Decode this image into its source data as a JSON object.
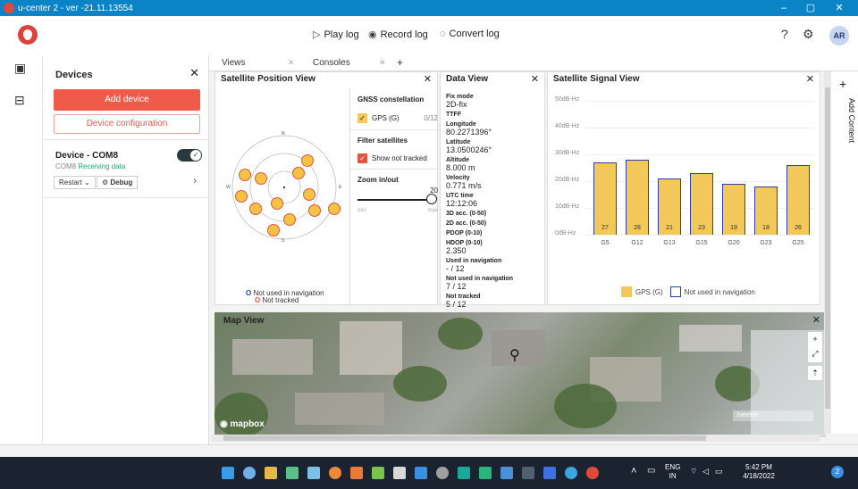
{
  "window": {
    "title": "u-center 2 - ver -21.11.13554",
    "min_label": "–",
    "max_label": "▢",
    "close_label": "✕"
  },
  "toolbar": {
    "play_label": "Play log",
    "record_label": "Record log",
    "convert_label": "Convert log",
    "avatar": "AR"
  },
  "devices": {
    "title": "Devices",
    "add_label": "Add device",
    "config_label": "Device configuration",
    "device": {
      "name": "Device - COM8",
      "port": "COM8",
      "status": "Receiving data",
      "connected": true,
      "restart_label": "Restart",
      "debug_label": "Debug"
    }
  },
  "tabs": [
    {
      "label": "Views"
    },
    {
      "label": "Consoles"
    }
  ],
  "satellite_position": {
    "title": "Satellite Position View",
    "constellation_heading": "GNSS constellation",
    "constellation": {
      "label": "GPS (G)",
      "count": "0/12",
      "checked": true
    },
    "filter_heading": "Filter satellites",
    "filter": {
      "label": "Show not tracked",
      "checked": true
    },
    "zoom_heading": "Zoom in/out",
    "zoom_value": "20",
    "zoom_min": "min",
    "zoom_max": "max",
    "compass": {
      "n": "N",
      "s": "S",
      "e": "E",
      "w": "W"
    },
    "legend_not_used": "Not used in navigation",
    "legend_not_tracked": "Not tracked"
  },
  "data_view": {
    "title": "Data View",
    "fields": [
      {
        "label": "Fix mode",
        "value": "2D-fix"
      },
      {
        "label": "TTFF",
        "value": ""
      },
      {
        "label": "Longitude",
        "value": "80.2271396°"
      },
      {
        "label": "Latitude",
        "value": "13.0500246°"
      },
      {
        "label": "Altitude",
        "value": "8.000 m"
      },
      {
        "label": "Velocity",
        "value": "0.771 m/s"
      },
      {
        "label": "UTC time",
        "value": "12:12:06"
      },
      {
        "label": "3D acc. (0-50)",
        "value": ""
      },
      {
        "label": "2D acc. (0-50)",
        "value": ""
      },
      {
        "label": "PDOP (0-10)",
        "value": ""
      },
      {
        "label": "HDOP (0-10)",
        "value": "2.350"
      },
      {
        "label": "Used in navigation",
        "value": "- / 12"
      },
      {
        "label": "Not used in navigation",
        "value": "7 / 12"
      },
      {
        "label": "Not tracked",
        "value": "5 / 12"
      }
    ]
  },
  "signal_view": {
    "title": "Satellite Signal View"
  },
  "chart_data": {
    "type": "bar",
    "title": "Satellite Signal View",
    "categories": [
      "G5",
      "G12",
      "G13",
      "G15",
      "G20",
      "G23",
      "G25"
    ],
    "values": [
      27,
      28,
      21,
      23,
      19,
      18,
      26
    ],
    "ylim": [
      0,
      50
    ],
    "yticks": [
      "0dB-Hz",
      "10dB-Hz",
      "20dB-Hz",
      "30dB-Hz",
      "40dB-Hz",
      "50dB-Hz"
    ],
    "legend": [
      "GPS (G)",
      "Not used in navigation"
    ],
    "colors": {
      "fill": "#f2c85a",
      "border": "#2c3fa1"
    }
  },
  "map": {
    "title": "Map View",
    "attribution": "mapbox",
    "style_label": "Satellite"
  },
  "side": {
    "add_content": "Add Content"
  },
  "taskbar": {
    "lang": "ENG",
    "region": "IN",
    "time": "5:42 PM",
    "date": "4/18/2022",
    "badge": "2"
  }
}
